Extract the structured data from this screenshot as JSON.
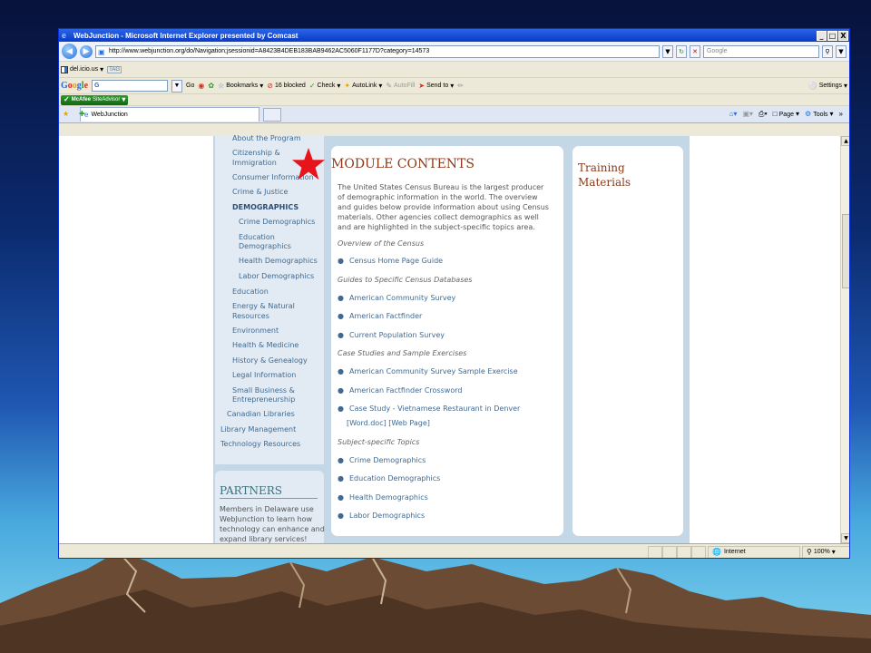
{
  "window": {
    "title": "WebJunction - Microsoft Internet Explorer presented by Comcast",
    "minimize": "_",
    "maximize": "□",
    "close": "X"
  },
  "addressbar": {
    "url": "http://www.webjunction.org/do/Navigation;jsessionid=A8423B4DEB183BAB9462AC5060F1177D?category=14573",
    "search_placeholder": "Google"
  },
  "toolbars": {
    "delicious": "del.icio.us",
    "tag": "TAG",
    "google_input": "G",
    "go": "Go",
    "bookmarks": "Bookmarks",
    "blocked": "16 blocked",
    "check": "Check",
    "autolink": "AutoLink",
    "autofill": "AutoFill",
    "send_to": "Send to",
    "settings": "Settings",
    "mcafee": "McAfee",
    "siteadvisor": "SiteAdvisor"
  },
  "tabs": {
    "active_tab": "WebJunction",
    "page_menu": "Page",
    "tools_menu": "Tools"
  },
  "left_nav": {
    "items": [
      {
        "label": "About the Program"
      },
      {
        "label": "Citizenship &"
      },
      {
        "label": "Immigration"
      },
      {
        "label": "Consumer Information"
      },
      {
        "label": "Crime & Justice"
      },
      {
        "label": "DEMOGRAPHICS"
      },
      {
        "label": "Crime Demographics"
      },
      {
        "label": "Education"
      },
      {
        "label": "Demographics"
      },
      {
        "label": "Health Demographics"
      },
      {
        "label": "Labor Demographics"
      },
      {
        "label": "Education"
      },
      {
        "label": "Energy & Natural"
      },
      {
        "label": "Resources"
      },
      {
        "label": "Environment"
      },
      {
        "label": "Health & Medicine"
      },
      {
        "label": "History & Genealogy"
      },
      {
        "label": "Legal Information"
      },
      {
        "label": "Small Business &"
      },
      {
        "label": "Entrepreneurship"
      },
      {
        "label": "Canadian Libraries"
      },
      {
        "label": "Library Management"
      },
      {
        "label": "Technology Resources"
      }
    ]
  },
  "partners": {
    "heading": "PARTNERS",
    "text": "Members in Delaware use WebJunction to learn how technology can enhance and expand library services!"
  },
  "module": {
    "heading": "MODULE CONTENTS",
    "intro": "The United States Census Bureau is the largest producer of demographic information in the world. The overview and guides below provide information about using Census materials. Other agencies collect demographics as well and are highlighted in the subject-specific topics area.",
    "overview_heading": "Overview of the Census",
    "overview_links": [
      "Census Home Page Guide"
    ],
    "guides_heading": "Guides to Specific Census Databases",
    "guides_links": [
      "American Community Survey",
      "American Factfinder",
      "Current Population Survey"
    ],
    "cases_heading": "Case Studies and Sample Exercises",
    "cases_links": [
      "American Community Survey Sample Exercise",
      "American Factfinder Crossword",
      "Case Study - Vietnamese Restaurant in Denver"
    ],
    "case_sublinks": [
      "[Word.doc]",
      "[Web Page]"
    ],
    "subject_heading": "Subject-specific Topics",
    "subject_links": [
      "Crime Demographics",
      "Education Demographics",
      "Health Demographics",
      "Labor Demographics"
    ]
  },
  "training": {
    "heading_line1": "Training",
    "heading_line2": "Materials"
  },
  "statusbar": {
    "zone": "Internet",
    "zoom": "100%"
  },
  "colors": {
    "link": "#3f6a93",
    "heading": "#8b3a19",
    "star": "#e8141c"
  }
}
